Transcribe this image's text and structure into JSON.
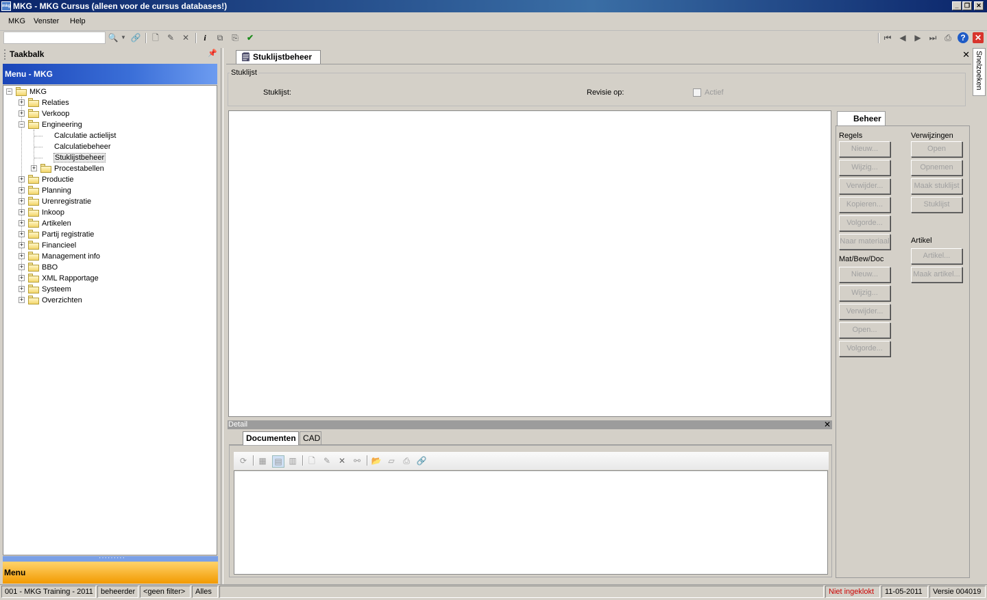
{
  "window": {
    "title": "MKG - MKG Cursus (alleen voor de cursus databases!)",
    "app_icon_label": "mkg"
  },
  "menubar": {
    "items": [
      "MKG",
      "Venster",
      "Help"
    ]
  },
  "toolbar": {
    "search_value": ""
  },
  "left_panel": {
    "title": "Taakbalk",
    "menu_header": "Menu - MKG",
    "bottom_label": "Menu",
    "tree": {
      "root": "MKG",
      "items": [
        "Relaties",
        "Verkoop",
        "Engineering",
        "Productie",
        "Planning",
        "Urenregistratie",
        "Inkoop",
        "Artikelen",
        "Partij registratie",
        "Financieel",
        "Management info",
        "BBO",
        "XML Rapportage",
        "Systeem",
        "Overzichten"
      ],
      "engineering_children": [
        "Calculatie actielijst",
        "Calculatiebeheer",
        "Stuklijstbeheer",
        "Procestabellen"
      ]
    }
  },
  "main": {
    "tab_title": "Stuklijstbeheer",
    "group_title": "Stuklijst",
    "fields": {
      "stuklijst": "Stuklijst:",
      "revisie": "Revisie op:",
      "actief": "Actief"
    }
  },
  "beheer": {
    "tab": "Beheer",
    "regels": {
      "title": "Regels",
      "buttons": [
        "Nieuw...",
        "Wijzig...",
        "Verwijder...",
        "Kopieren...",
        "Volgorde...",
        "Naar materiaal"
      ]
    },
    "matbewdoc": {
      "title": "Mat/Bew/Doc",
      "buttons": [
        "Nieuw...",
        "Wijzig...",
        "Verwijder...",
        "Open...",
        "Volgorde..."
      ]
    },
    "verwijzingen": {
      "title": "Verwijzingen",
      "buttons": [
        "Open",
        "Opnemen",
        "Maak stuklijst",
        "Stuklijst"
      ]
    },
    "artikel": {
      "title": "Artikel",
      "buttons": [
        "Artikel...",
        "Maak artikel..."
      ]
    }
  },
  "detail": {
    "title": "Detail",
    "tabs": [
      "Documenten",
      "CAD"
    ]
  },
  "side_tab": "Snelzoeken",
  "statusbar": {
    "company": "001 - MKG Training - 2011",
    "user": "beheerder",
    "filter": "<geen filter>",
    "scope": "Alles",
    "clock_status": "Niet ingeklokt",
    "date": "11-05-2011",
    "version": "Versie 004019"
  },
  "colors": {
    "title_bar": "#0a246a",
    "menu_header": "#1a45b8",
    "menu_bottom": "#f29a00",
    "status_red": "#cc0000"
  }
}
